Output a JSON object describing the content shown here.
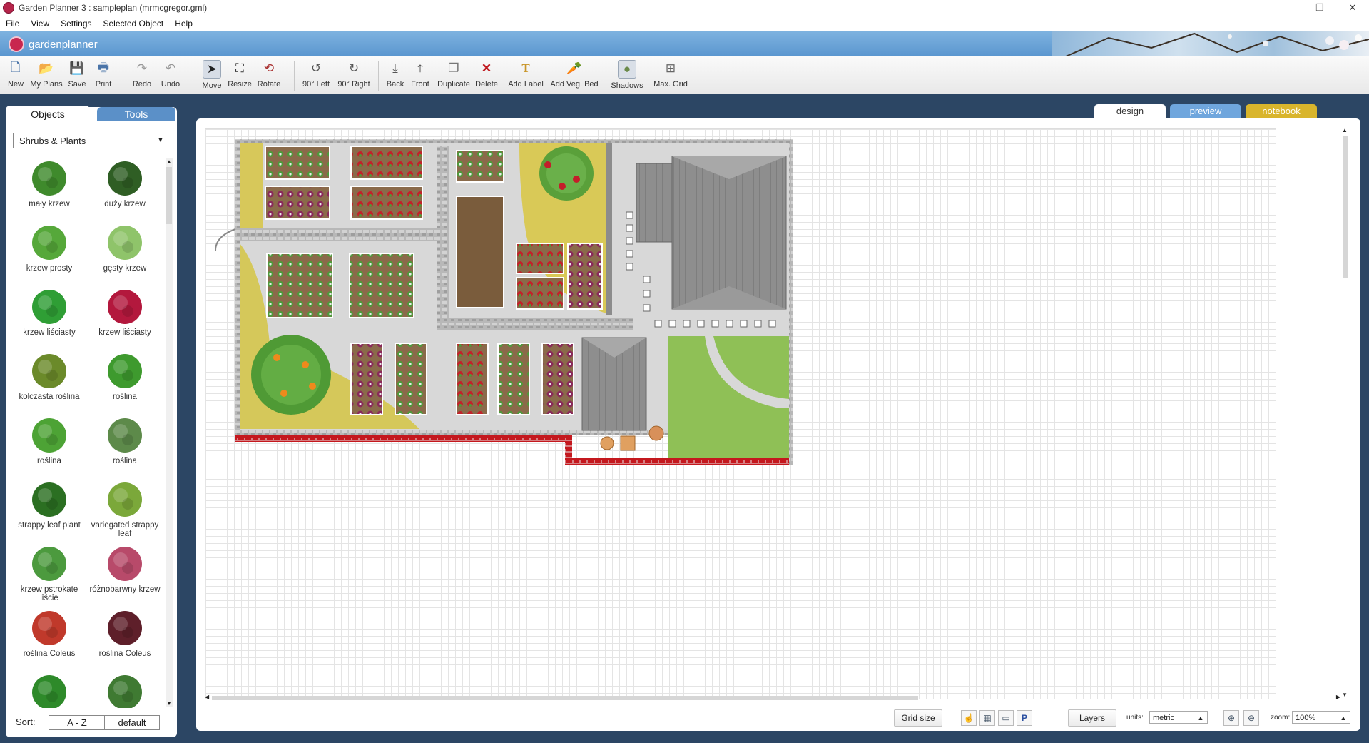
{
  "window": {
    "title": "Garden Planner 3 : sampleplan (mrmcgregor.gml)",
    "controls": [
      "—",
      "❐",
      "✕"
    ]
  },
  "menu": [
    "File",
    "View",
    "Settings",
    "Selected Object",
    "Help"
  ],
  "brand": {
    "name": "gardenplanner"
  },
  "toolbar": {
    "new": "New",
    "my_plans": "My Plans",
    "save": "Save",
    "print": "Print",
    "redo": "Redo",
    "undo": "Undo",
    "move": "Move",
    "resize": "Resize",
    "rotate": "Rotate",
    "rot_left": "90° Left",
    "rot_right": "90° Right",
    "back": "Back",
    "front": "Front",
    "duplicate": "Duplicate",
    "delete": "Delete",
    "add_label": "Add Label",
    "add_veg_bed": "Add Veg. Bed",
    "shadows": "Shadows",
    "max_grid": "Max. Grid"
  },
  "left_panel": {
    "tabs": {
      "objects": "Objects",
      "tools": "Tools"
    },
    "category": "Shrubs & Plants",
    "items": [
      {
        "label": "mały krzew",
        "color": "#3f8a2c"
      },
      {
        "label": "duży krzew",
        "color": "#2f5e24"
      },
      {
        "label": "krzew prosty",
        "color": "#56a83a"
      },
      {
        "label": "gęsty krzew",
        "color": "#8fc46a"
      },
      {
        "label": "krzew liściasty",
        "color": "#2f9e35"
      },
      {
        "label": "krzew liściasty",
        "color": "#b3183d"
      },
      {
        "label": "kolczasta roślina",
        "color": "#6b8a2a"
      },
      {
        "label": "roślina",
        "color": "#3e9a2e"
      },
      {
        "label": "roślina",
        "color": "#4da335"
      },
      {
        "label": "roślina",
        "color": "#5d8a4a"
      },
      {
        "label": "strappy leaf plant",
        "color": "#2b6f22"
      },
      {
        "label": "variegated strappy leaf",
        "color": "#7ba83a"
      },
      {
        "label": "krzew pstrokate liście",
        "color": "#4c9a3e"
      },
      {
        "label": "różnobarwny krzew",
        "color": "#b84a6a"
      },
      {
        "label": "roślina Coleus",
        "color": "#c0392b"
      },
      {
        "label": "roślina Coleus",
        "color": "#5e1f2a"
      },
      {
        "label": "",
        "color": "#2e8a2a"
      },
      {
        "label": "",
        "color": "#3f7a32"
      }
    ],
    "sort": {
      "label": "Sort:",
      "az": "A - Z",
      "default": "default"
    }
  },
  "view_tabs": {
    "design": "design",
    "preview": "preview",
    "notebook": "notebook"
  },
  "statusbar": {
    "grid_size": "Grid size",
    "layers": "Layers",
    "units_label": "units:",
    "units_value": "metric",
    "zoom_label": "zoom:",
    "zoom_value": "100%"
  }
}
